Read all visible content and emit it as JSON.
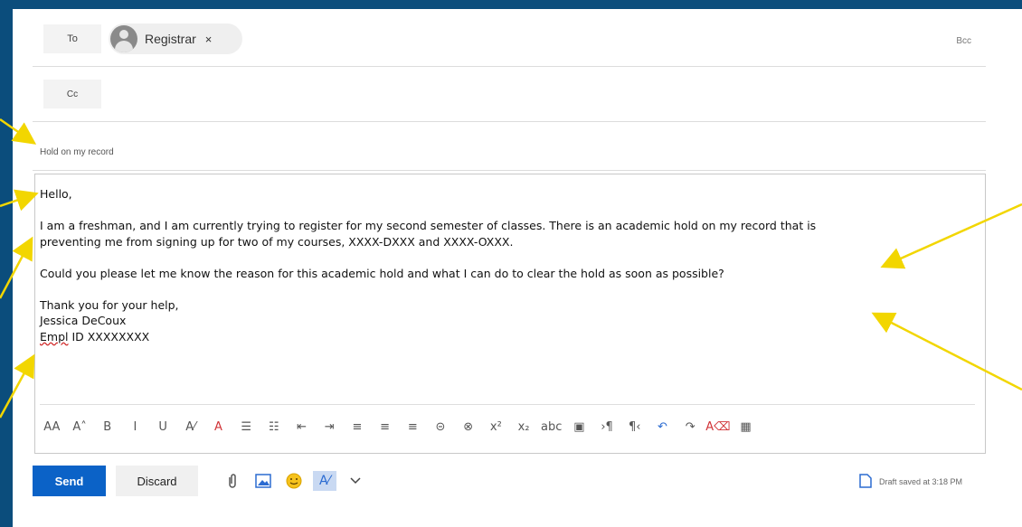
{
  "compose": {
    "to_label": "To",
    "cc_label": "Cc",
    "bcc_label": "Bcc",
    "recipient": "Registrar",
    "recipient_remove": "×",
    "subject": "Hold on my record",
    "body": {
      "greeting": "Hello,",
      "para1_line1": "I am a freshman, and I am currently trying to register for my second semester of classes. There is an academic hold on my record that is",
      "para1_line2": "preventing me from signing up for two of my courses, XXXX-DXXX and XXXX-OXXX.",
      "para2": "Could you please let me know the reason for this academic hold and what I can do to clear the hold as soon as possible?",
      "closing": "Thank you for your help,",
      "sig_name": "Jessica DeCoux",
      "sig_id_prefix": "Empl",
      "sig_id_rest": " ID XXXXXXXX"
    }
  },
  "toolbar": {
    "items": [
      {
        "name": "font-size-icon",
        "glyph": "AA"
      },
      {
        "name": "grow-font-icon",
        "glyph": "A˄"
      },
      {
        "name": "bold-icon",
        "glyph": "B"
      },
      {
        "name": "italic-icon",
        "glyph": "I"
      },
      {
        "name": "underline-icon",
        "glyph": "U"
      },
      {
        "name": "highlight-icon",
        "glyph": "A⁄"
      },
      {
        "name": "font-color-icon",
        "glyph": "A"
      },
      {
        "name": "bullets-icon",
        "glyph": "☰"
      },
      {
        "name": "numbering-icon",
        "glyph": "☷"
      },
      {
        "name": "decrease-indent-icon",
        "glyph": "⇤"
      },
      {
        "name": "increase-indent-icon",
        "glyph": "⇥"
      },
      {
        "name": "align-left-icon",
        "glyph": "≡"
      },
      {
        "name": "align-center-icon",
        "glyph": "≡"
      },
      {
        "name": "align-right-icon",
        "glyph": "≡"
      },
      {
        "name": "insert-link-icon",
        "glyph": "⊝"
      },
      {
        "name": "remove-link-icon",
        "glyph": "⊗"
      },
      {
        "name": "superscript-icon",
        "glyph": "x²"
      },
      {
        "name": "subscript-icon",
        "glyph": "x₂"
      },
      {
        "name": "strikethrough-icon",
        "glyph": "abc"
      },
      {
        "name": "insert-image-icon",
        "glyph": "▣"
      },
      {
        "name": "ltr-icon",
        "glyph": "›¶"
      },
      {
        "name": "rtl-icon",
        "glyph": "¶‹"
      },
      {
        "name": "undo-icon",
        "glyph": "↶"
      },
      {
        "name": "redo-icon",
        "glyph": "↷"
      },
      {
        "name": "clear-format-icon",
        "glyph": "A⌫"
      },
      {
        "name": "table-icon",
        "glyph": "▦"
      }
    ]
  },
  "actions": {
    "send_label": "Send",
    "discard_label": "Discard",
    "draft_status": "Draft saved at 3:18 PM"
  },
  "colors": {
    "background": "#0b4d7c",
    "accent": "#0b62c7",
    "arrow": "#f2d600"
  }
}
